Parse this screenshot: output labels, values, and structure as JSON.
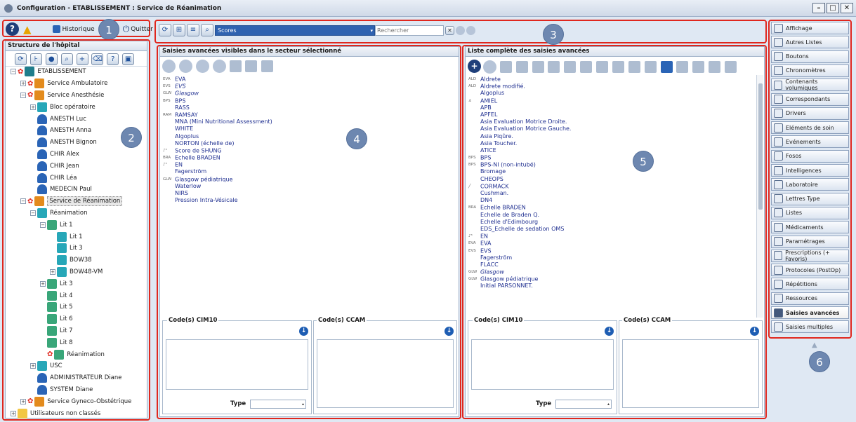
{
  "window": {
    "title": "Configuration - ETABLISSEMENT : Service de Réanimation",
    "controls": [
      "–",
      "□",
      "✕"
    ]
  },
  "callouts": [
    "1",
    "2",
    "3",
    "4",
    "5",
    "6"
  ],
  "topbar": {
    "historique_label": "Historique",
    "quitter_label": "Quitter"
  },
  "left_panel": {
    "title": "Structure de l'hôpital",
    "tree": [
      {
        "label": "ETABLISSEMENT",
        "indent": 0,
        "icon": "etab",
        "gear": true,
        "exp": "−"
      },
      {
        "label": "Service Ambulatoire",
        "indent": 1,
        "icon": "svc",
        "gear": true,
        "exp": "+"
      },
      {
        "label": "Service Anesthésie",
        "indent": 1,
        "icon": "svc",
        "gear": true,
        "exp": "−"
      },
      {
        "label": "Bloc opératoire",
        "indent": 2,
        "icon": "bloc",
        "gear": false,
        "exp": "+"
      },
      {
        "label": "ANESTH Luc",
        "indent": 2,
        "icon": "user",
        "gear": false,
        "exp": ""
      },
      {
        "label": "ANESTH Anna",
        "indent": 2,
        "icon": "user",
        "gear": false,
        "exp": ""
      },
      {
        "label": "ANESTH Bignon",
        "indent": 2,
        "icon": "user",
        "gear": false,
        "exp": ""
      },
      {
        "label": "CHIR Alex",
        "indent": 2,
        "icon": "user",
        "gear": false,
        "exp": ""
      },
      {
        "label": "CHIR Jean",
        "indent": 2,
        "icon": "user",
        "gear": false,
        "exp": ""
      },
      {
        "label": "CHIR Léa",
        "indent": 2,
        "icon": "user",
        "gear": false,
        "exp": ""
      },
      {
        "label": "MEDECIN Paul",
        "indent": 2,
        "icon": "user",
        "gear": false,
        "exp": ""
      },
      {
        "label": "Service de Réanimation",
        "indent": 1,
        "icon": "svc",
        "gear": true,
        "exp": "−",
        "selected": true
      },
      {
        "label": "Réanimation",
        "indent": 2,
        "icon": "bloc",
        "gear": false,
        "exp": "−"
      },
      {
        "label": "Lit 1",
        "indent": 3,
        "icon": "lit",
        "gear": false,
        "exp": "−"
      },
      {
        "label": "Lit 1",
        "indent": 4,
        "icon": "bloc",
        "gear": false,
        "exp": ""
      },
      {
        "label": "Lit 3",
        "indent": 4,
        "icon": "bloc",
        "gear": false,
        "exp": ""
      },
      {
        "label": "BOW38",
        "indent": 4,
        "icon": "bloc",
        "gear": false,
        "exp": ""
      },
      {
        "label": "BOW48-VM",
        "indent": 4,
        "icon": "bloc",
        "gear": false,
        "exp": "+"
      },
      {
        "label": "Lit 3",
        "indent": 3,
        "icon": "lit",
        "gear": false,
        "exp": "+"
      },
      {
        "label": "Lit 4",
        "indent": 3,
        "icon": "lit",
        "gear": false,
        "exp": ""
      },
      {
        "label": "Lit 5",
        "indent": 3,
        "icon": "lit",
        "gear": false,
        "exp": ""
      },
      {
        "label": "Lit 6",
        "indent": 3,
        "icon": "lit",
        "gear": false,
        "exp": ""
      },
      {
        "label": "Lit 7",
        "indent": 3,
        "icon": "lit",
        "gear": false,
        "exp": ""
      },
      {
        "label": "Lit 8",
        "indent": 3,
        "icon": "lit",
        "gear": false,
        "exp": ""
      },
      {
        "label": "Réanimation",
        "indent": 3,
        "icon": "lit",
        "gear": true,
        "exp": ""
      },
      {
        "label": "USC",
        "indent": 2,
        "icon": "bloc",
        "gear": false,
        "exp": "+"
      },
      {
        "label": "ADMINISTRATEUR Diane",
        "indent": 2,
        "icon": "user",
        "gear": false,
        "exp": ""
      },
      {
        "label": "SYSTEM Diane",
        "indent": 2,
        "icon": "user",
        "gear": false,
        "exp": ""
      },
      {
        "label": "Service Gyneco-Obstétrique",
        "indent": 1,
        "icon": "svc",
        "gear": true,
        "exp": "+"
      },
      {
        "label": "Utilisateurs non classés",
        "indent": 0,
        "icon": "folder",
        "gear": false,
        "exp": "+"
      }
    ]
  },
  "toolbar": {
    "combo_value": "Scores",
    "search_placeholder": "Rechercher"
  },
  "middle_panel": {
    "title": "Saisies avancées visibles dans le secteur sélectionné",
    "items": [
      {
        "prefix": "EVA",
        "label": "EVA"
      },
      {
        "prefix": "EVS",
        "label": "EVS",
        "italic": true
      },
      {
        "prefix": "GLW",
        "label": "Glasgow",
        "italic": true
      },
      {
        "prefix": "BPS",
        "label": "BPS"
      },
      {
        "prefix": "",
        "label": "RASS"
      },
      {
        "prefix": "RAM",
        "label": "RAMSAY"
      },
      {
        "prefix": "",
        "label": "MNA (Mini Nutritional Assessment)"
      },
      {
        "prefix": "",
        "label": "WHITE"
      },
      {
        "prefix": "",
        "label": "Algoplus"
      },
      {
        "prefix": "",
        "label": "NORTON (échelle de)"
      },
      {
        "prefix": "♪³",
        "label": "Score de SHUNG"
      },
      {
        "prefix": "BRA",
        "label": "Echelle BRADEN"
      },
      {
        "prefix": "♪³",
        "label": "EN"
      },
      {
        "prefix": "",
        "label": "Fagerström"
      },
      {
        "prefix": "GLW",
        "label": "Glasgow pédiatrique"
      },
      {
        "prefix": "",
        "label": "Waterlow"
      },
      {
        "prefix": "",
        "label": "NIRS"
      },
      {
        "prefix": "",
        "label": "Pression Intra-Vésicale"
      }
    ],
    "cim10_label": "Code(s) CIM10",
    "ccam_label": "Code(s) CCAM",
    "type_label": "Type"
  },
  "right_list_panel": {
    "title": "Liste complète des saisies avancées",
    "items": [
      {
        "prefix": "ALD",
        "label": "Aldrete"
      },
      {
        "prefix": "ALD",
        "label": "Aldrete modifié."
      },
      {
        "prefix": "",
        "label": "Algoplus"
      },
      {
        "prefix": "♙",
        "label": "AMIEL"
      },
      {
        "prefix": "",
        "label": "APB"
      },
      {
        "prefix": "",
        "label": "APFEL"
      },
      {
        "prefix": "",
        "label": "Asia Evaluation Motrice Droite."
      },
      {
        "prefix": "",
        "label": "Asia Evaluation Motrice Gauche."
      },
      {
        "prefix": "",
        "label": "Asia Piqûre."
      },
      {
        "prefix": "",
        "label": "Asia Toucher."
      },
      {
        "prefix": "",
        "label": "ATICE"
      },
      {
        "prefix": "BPS",
        "label": "BPS"
      },
      {
        "prefix": "BPS",
        "label": "BPS-NI (non-intubé)"
      },
      {
        "prefix": "",
        "label": "Bromage"
      },
      {
        "prefix": "",
        "label": "CHEOPS"
      },
      {
        "prefix": "╱",
        "label": "CORMACK"
      },
      {
        "prefix": "",
        "label": "Cushman."
      },
      {
        "prefix": "",
        "label": "DN4"
      },
      {
        "prefix": "BRA",
        "label": "Echelle BRADEN"
      },
      {
        "prefix": "",
        "label": "Echelle de Braden Q."
      },
      {
        "prefix": "",
        "label": "Echelle d'Edimbourg"
      },
      {
        "prefix": "",
        "label": "EDS_Echelle de sedation OMS"
      },
      {
        "prefix": "♪³",
        "label": "EN"
      },
      {
        "prefix": "EVA",
        "label": "EVA"
      },
      {
        "prefix": "EVS",
        "label": "EVS"
      },
      {
        "prefix": "",
        "label": "Fagerström"
      },
      {
        "prefix": "",
        "label": "FLACC"
      },
      {
        "prefix": "GLW",
        "label": "Glasgow",
        "italic": true
      },
      {
        "prefix": "GLW",
        "label": "Glasgow pédiatrique"
      },
      {
        "prefix": "",
        "label": "Initial PARSONNET."
      }
    ],
    "cim10_label": "Code(s) CIM10",
    "ccam_label": "Code(s) CCAM",
    "type_label": "Type"
  },
  "sidebar": {
    "items": [
      {
        "label": "Affichage",
        "icon": "monitor-icon"
      },
      {
        "label": "Autres Listes",
        "icon": "list-icon"
      },
      {
        "label": "Boutons",
        "icon": "buttons-icon"
      },
      {
        "label": "Chronomètres",
        "icon": "clock-icon"
      },
      {
        "label": "Contenants volumiques",
        "icon": "syringe-icon"
      },
      {
        "label": "Correspondants",
        "icon": "contact-icon"
      },
      {
        "label": "Drivers",
        "icon": "driver-icon"
      },
      {
        "label": "Eléments de soin",
        "icon": "person-icon"
      },
      {
        "label": "Evénements",
        "icon": "events-icon"
      },
      {
        "label": "Fosos",
        "icon": "fosos-icon"
      },
      {
        "label": "Intelligences",
        "icon": "puzzle-icon"
      },
      {
        "label": "Laboratoire",
        "icon": "lab-icon"
      },
      {
        "label": "Lettres Type",
        "icon": "letter-icon"
      },
      {
        "label": "Listes",
        "icon": "list-icon"
      },
      {
        "label": "Médicaments",
        "icon": "medication-icon"
      },
      {
        "label": "Paramétrages",
        "icon": "settings-icon"
      },
      {
        "label": "Prescriptions (+ Favoris)",
        "icon": "prescription-icon"
      },
      {
        "label": "Protocoles (PostOp)",
        "icon": "protocol-icon"
      },
      {
        "label": "Répétitions",
        "icon": "repeat-icon"
      },
      {
        "label": "Ressources",
        "icon": "resources-icon"
      },
      {
        "label": "Saisies avancées",
        "icon": "advanced-input-icon",
        "active": true
      },
      {
        "label": "Saisies multiples",
        "icon": "multi-input-icon"
      }
    ]
  }
}
